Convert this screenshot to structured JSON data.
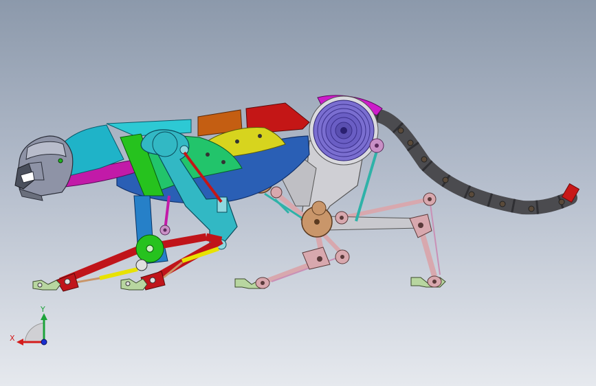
{
  "triad": {
    "x_label": "X",
    "y_label": "Y",
    "x_color": "#d41c1c",
    "y_color": "#1ca33a",
    "z_color": "#1a2fd0"
  },
  "palette": {
    "head": "#8e93a6",
    "head_dark": "#4a4f5c",
    "neck": "#1fb3c8",
    "torso_top": "#2dc9d4",
    "torso_magenta": "#c21aa8",
    "belly": "#2a5fb5",
    "shoulder_blade": "#22c46b",
    "spine_orange": "#c45e12",
    "spine_red": "#c41616",
    "hip_magenta": "#cc1cc9",
    "gear": "#6a5ec4",
    "frame_gray": "#cfcfd4",
    "tail": "#4b4b4f",
    "tail_tip": "#c81818",
    "leg_red": "#c0141a",
    "leg_yellow": "#e8e200",
    "leg_green": "#26c21e",
    "leg_blue": "#2680c8",
    "teal_link": "#2fb2a8",
    "pink_link": "#d8a8ae",
    "joint_tan": "#c9966a",
    "paw_green": "#b8d6a0"
  }
}
